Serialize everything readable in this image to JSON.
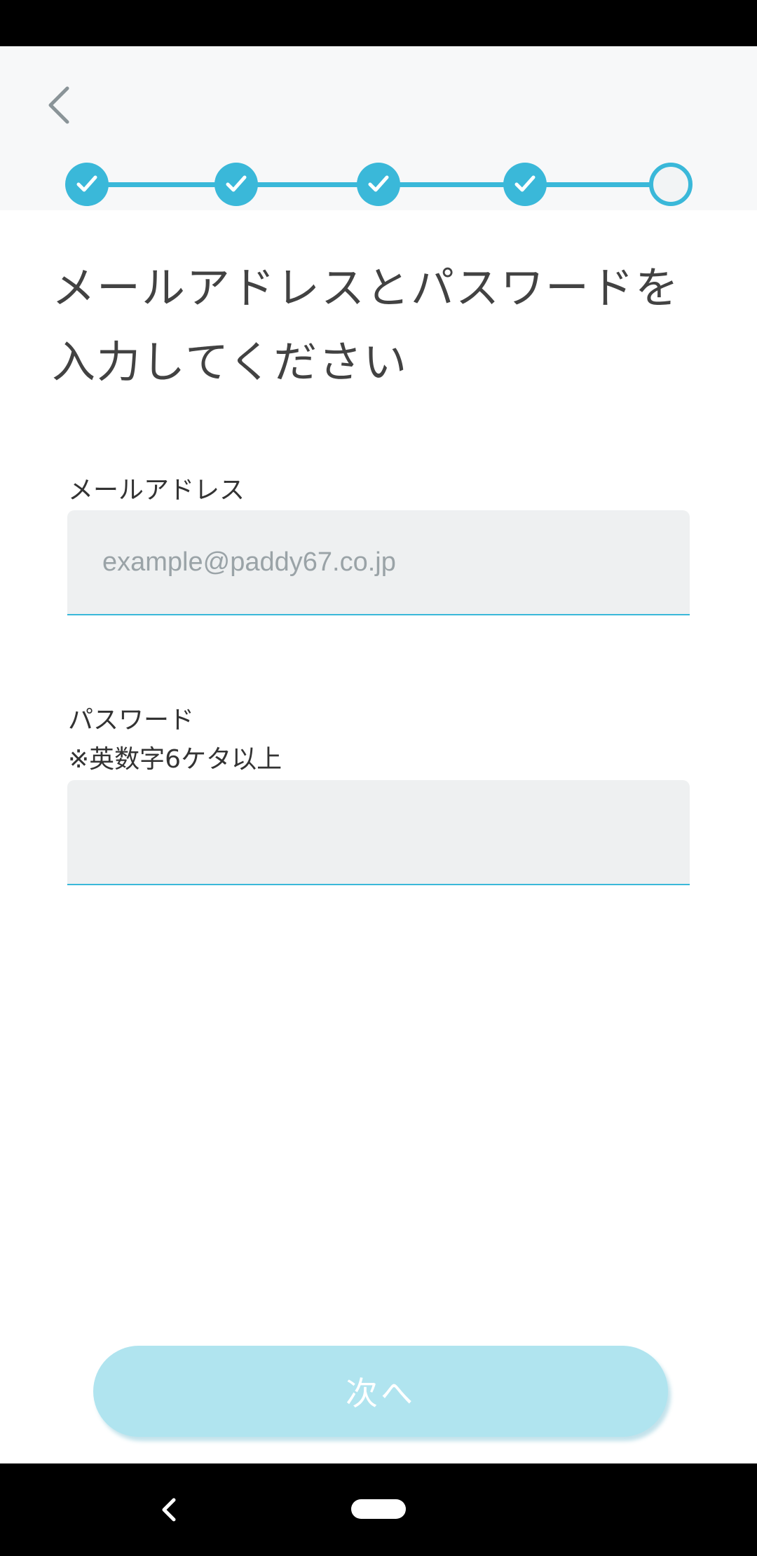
{
  "header": {
    "back_icon": "chevron-left-icon",
    "progress": {
      "total_steps": 5,
      "completed_steps": 4,
      "current_step": 5,
      "completed_icon": "check-icon"
    }
  },
  "main": {
    "title": "メールアドレスとパスワードを入力してください",
    "email": {
      "label": "メールアドレス",
      "placeholder": "example@paddy67.co.jp",
      "value": ""
    },
    "password": {
      "label": "パスワード",
      "hint": "※英数字6ケタ以上",
      "value": ""
    }
  },
  "footer": {
    "next_label": "次へ"
  },
  "colors": {
    "accent": "#3ab8d9",
    "button_disabled": "#b0e4ef",
    "input_background": "#eef0f1",
    "title_text": "#424242"
  }
}
